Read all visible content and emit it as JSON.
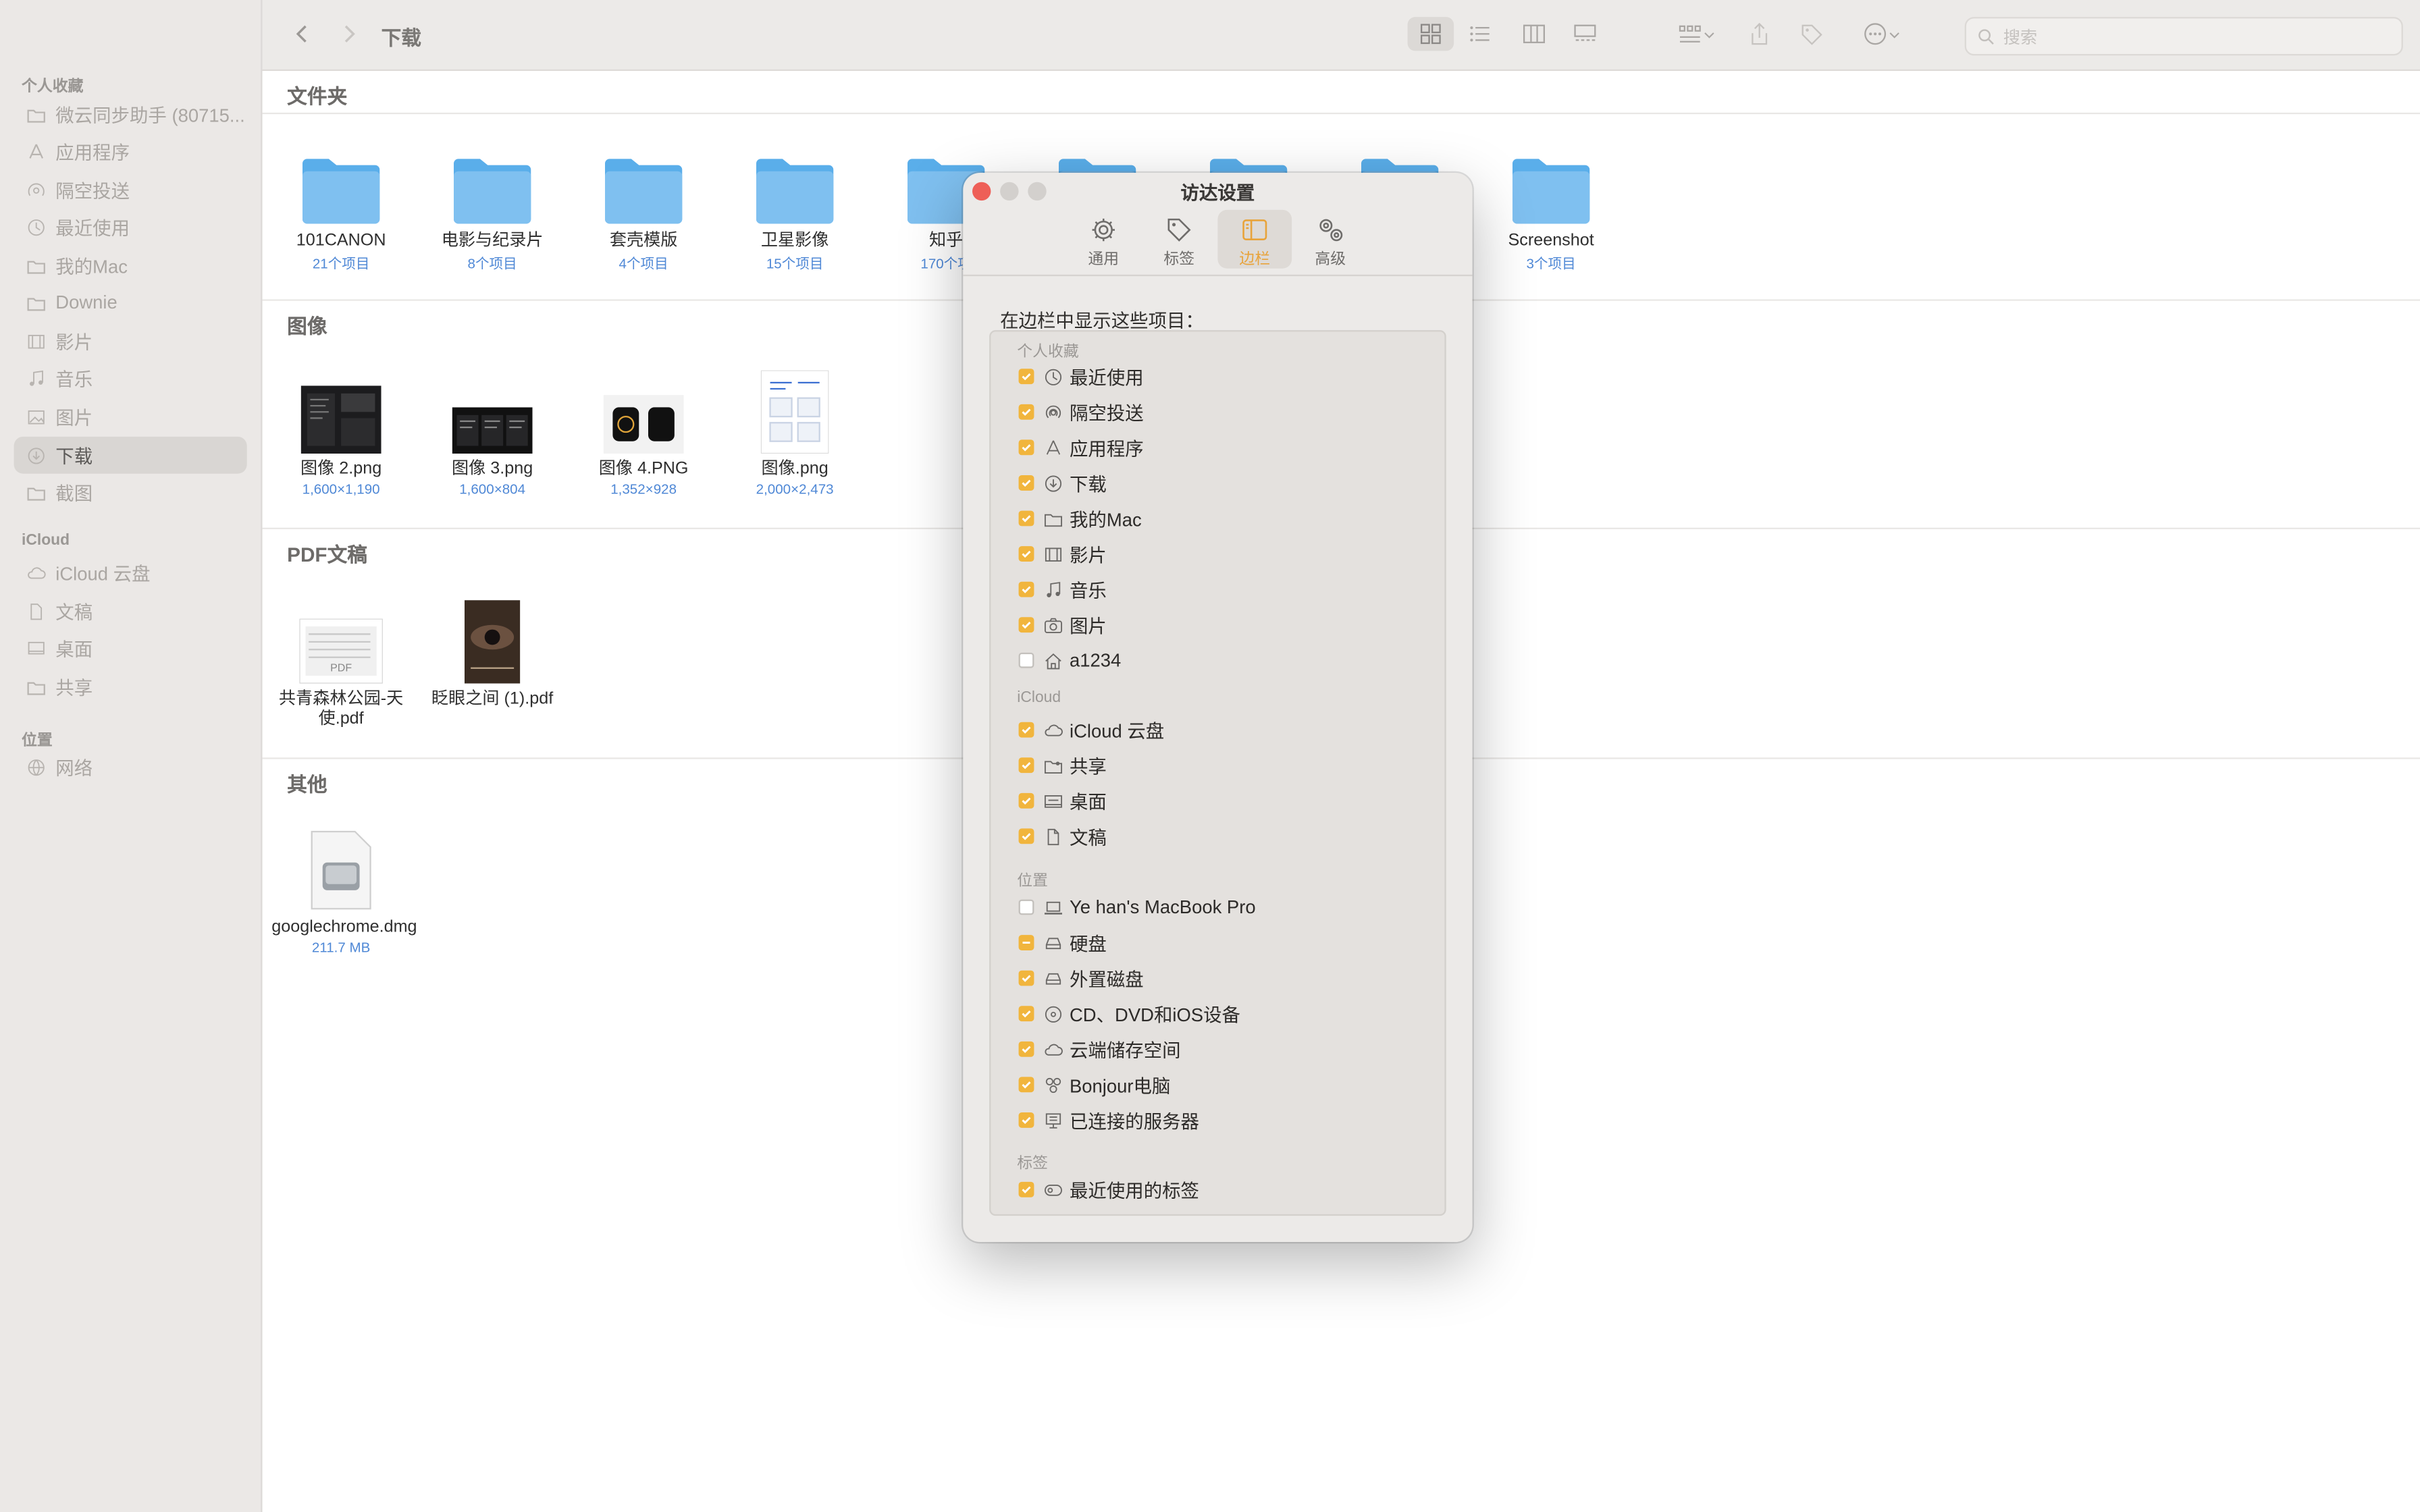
{
  "sidebar": {
    "favorites_header": "个人收藏",
    "favorites": [
      {
        "label": "微云同步助手 (80715...",
        "icon": "folder-icon"
      },
      {
        "label": "应用程序",
        "icon": "apps-icon"
      },
      {
        "label": "隔空投送",
        "icon": "airdrop-icon"
      },
      {
        "label": "最近使用",
        "icon": "clock-icon"
      },
      {
        "label": "我的Mac",
        "icon": "folder-icon"
      },
      {
        "label": "Downie",
        "icon": "folder-icon"
      },
      {
        "label": "影片",
        "icon": "film-icon"
      },
      {
        "label": "音乐",
        "icon": "music-icon"
      },
      {
        "label": "图片",
        "icon": "photo-icon"
      },
      {
        "label": "下载",
        "icon": "download-icon"
      },
      {
        "label": "截图",
        "icon": "folder-icon"
      }
    ],
    "icloud_header": "iCloud",
    "icloud": [
      {
        "label": "iCloud 云盘",
        "icon": "cloud-icon"
      },
      {
        "label": "文稿",
        "icon": "document-icon"
      },
      {
        "label": "桌面",
        "icon": "desktop-icon"
      },
      {
        "label": "共享",
        "icon": "shared-folder-icon"
      }
    ],
    "locations_header": "位置",
    "locations": [
      {
        "label": "网络",
        "icon": "network-icon"
      }
    ]
  },
  "toolbar": {
    "title": "下载",
    "search_placeholder": "搜索"
  },
  "content": {
    "folders_header": "文件夹",
    "folders": [
      {
        "name": "101CANON",
        "meta": "21个项目"
      },
      {
        "name": "电影与纪录片",
        "meta": "8个项目"
      },
      {
        "name": "套壳模版",
        "meta": "4个项目"
      },
      {
        "name": "卫星影像",
        "meta": "15个项目"
      },
      {
        "name": "知乎",
        "meta": "170个项"
      },
      {
        "name": "Screenshot",
        "meta": "3个项目"
      }
    ],
    "images_header": "图像",
    "images": [
      {
        "name": "图像 2.png",
        "meta": "1,600×1,190"
      },
      {
        "name": "图像 3.png",
        "meta": "1,600×804"
      },
      {
        "name": "图像 4.PNG",
        "meta": "1,352×928"
      },
      {
        "name": "图像.png",
        "meta": "2,000×2,473"
      }
    ],
    "pdf_header": "PDF文稿",
    "pdfs": [
      {
        "name": "共青森林公园-天使.pdf",
        "thumb_label": "PDF"
      },
      {
        "name": "眨眼之间 (1).pdf"
      }
    ],
    "other_header": "其他",
    "others": [
      {
        "name": "googlechrome.dmg",
        "meta": "211.7 MB"
      }
    ]
  },
  "dialog": {
    "title": "访达设置",
    "tabs": [
      {
        "label": "通用",
        "icon": "gear-icon"
      },
      {
        "label": "标签",
        "icon": "tag-icon"
      },
      {
        "label": "边栏",
        "icon": "sidebar-icon",
        "selected": true
      },
      {
        "label": "高级",
        "icon": "gears-icon"
      }
    ],
    "caption": "在边栏中显示这些项目：",
    "groups": [
      {
        "header": "个人收藏",
        "items": [
          {
            "label": "最近使用",
            "state": "checked",
            "icon": "clock-icon"
          },
          {
            "label": "隔空投送",
            "state": "checked",
            "icon": "airdrop-icon"
          },
          {
            "label": "应用程序",
            "state": "checked",
            "icon": "apps-icon"
          },
          {
            "label": "下载",
            "state": "checked",
            "icon": "download-icon"
          },
          {
            "label": "我的Mac",
            "state": "checked",
            "icon": "folder-icon"
          },
          {
            "label": "影片",
            "state": "checked",
            "icon": "film-icon"
          },
          {
            "label": "音乐",
            "state": "checked",
            "icon": "music-icon"
          },
          {
            "label": "图片",
            "state": "checked",
            "icon": "camera-icon"
          },
          {
            "label": "a1234",
            "state": "unchecked",
            "icon": "home-icon"
          }
        ]
      },
      {
        "header": "iCloud",
        "items": [
          {
            "label": "iCloud 云盘",
            "state": "checked",
            "icon": "cloud-icon"
          },
          {
            "label": "共享",
            "state": "checked",
            "icon": "shared-folder-icon"
          },
          {
            "label": "桌面",
            "state": "checked",
            "icon": "desktop-icon"
          },
          {
            "label": "文稿",
            "state": "checked",
            "icon": "document-icon"
          }
        ]
      },
      {
        "header": "位置",
        "items": [
          {
            "label": "Ye han's MacBook Pro",
            "state": "unchecked",
            "icon": "laptop-icon"
          },
          {
            "label": "硬盘",
            "state": "mixed",
            "icon": "drive-icon"
          },
          {
            "label": "外置磁盘",
            "state": "checked",
            "icon": "drive-icon"
          },
          {
            "label": "CD、DVD和iOS设备",
            "state": "checked",
            "icon": "disc-icon"
          },
          {
            "label": "云端储存空间",
            "state": "checked",
            "icon": "cloud-icon"
          },
          {
            "label": "Bonjour电脑",
            "state": "checked",
            "icon": "bonjour-icon"
          },
          {
            "label": "已连接的服务器",
            "state": "checked",
            "icon": "server-icon"
          }
        ]
      },
      {
        "header": "标签",
        "items": [
          {
            "label": "最近使用的标签",
            "state": "checked",
            "icon": "tag-outline-icon"
          }
        ]
      }
    ]
  },
  "colors": {
    "accent": "#f1b53d",
    "folder": "#7fc0f0",
    "link_meta": "#4f88d6",
    "close": "#ee5f57"
  }
}
